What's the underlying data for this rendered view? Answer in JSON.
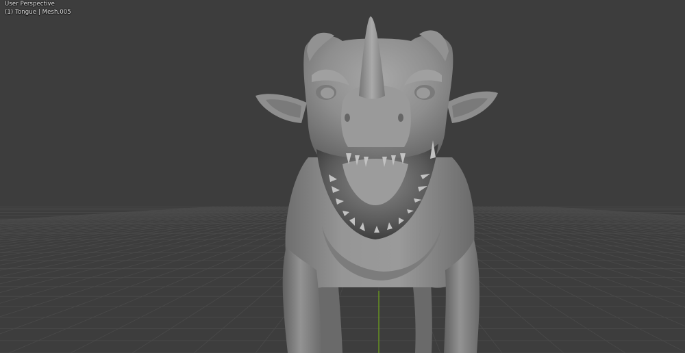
{
  "viewport": {
    "view_mode": "User Perspective",
    "frame": "(1)",
    "active_object": "Tongue",
    "active_mesh": "Mesh.005",
    "info_line": "(1) Tongue | Mesh.005",
    "background_color": "#3d3d3d",
    "grid_color": "#4a4a4a",
    "y_axis_color": "#6fa51a",
    "model_color": "#8c8c8c",
    "model_subject": "dragon-sculpt"
  }
}
